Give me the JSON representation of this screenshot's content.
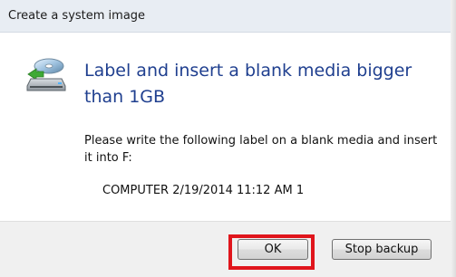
{
  "window": {
    "title": "Create a system image"
  },
  "icons": {
    "heading_icon": "backup-drive-icon"
  },
  "content": {
    "heading": "Label and insert a blank media bigger than 1GB",
    "message": "Please write the following label on a blank media and insert it into F:",
    "label_value": "COMPUTER 2/19/2014 11:12 AM  1"
  },
  "buttons": {
    "ok_label": "OK",
    "stop_backup_label": "Stop backup"
  },
  "colors": {
    "heading": "#1f3f8f",
    "highlight": "#e0151c",
    "titlebar": "#e8edf3",
    "footer": "#f0f0f0"
  }
}
